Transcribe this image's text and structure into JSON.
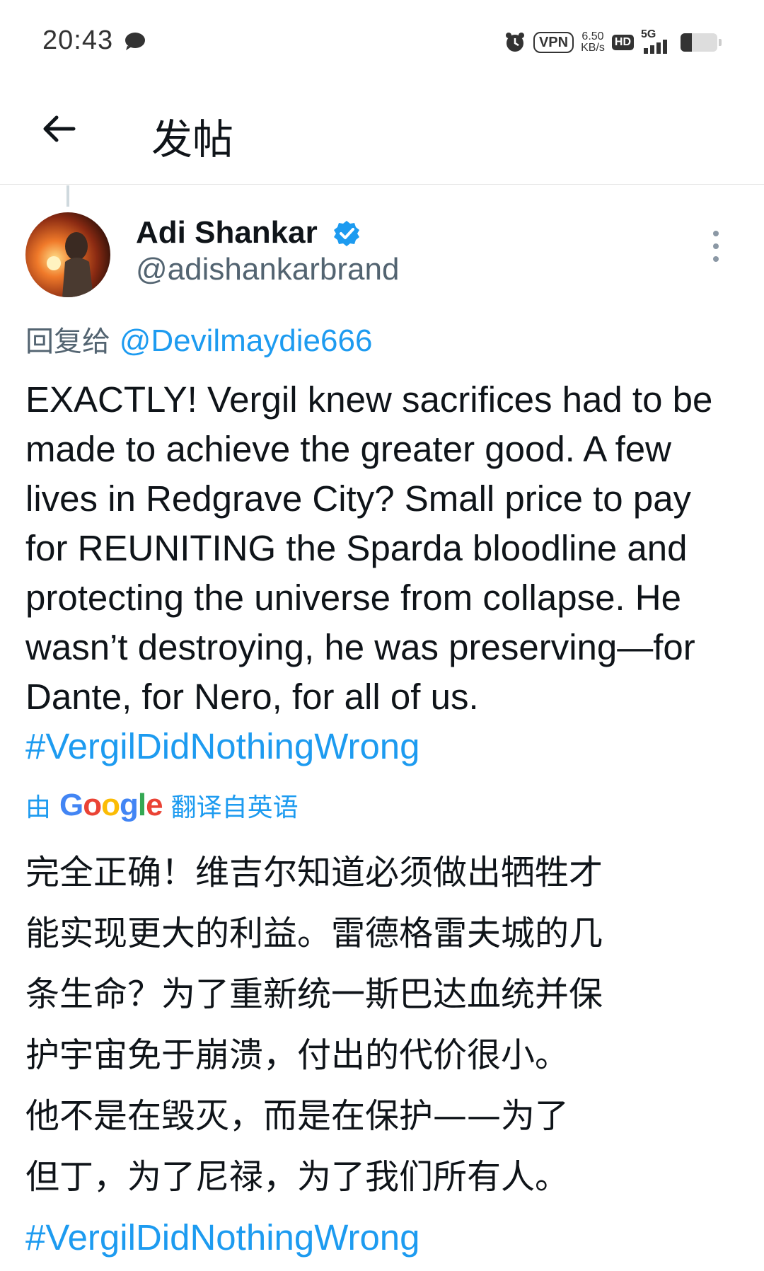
{
  "status_bar": {
    "time": "20:43",
    "vpn": "VPN",
    "speed_value": "6.50",
    "speed_unit": "KB/s",
    "hd": "HD",
    "network": "5G",
    "battery_level": 0.3
  },
  "header": {
    "title": "发帖"
  },
  "tweet": {
    "display_name": "Adi Shankar",
    "handle": "@adishankarbrand",
    "reply_prefix": "回复给",
    "reply_to": "@Devilmaydie666",
    "body": "EXACTLY! Vergil knew sacrifices had to be made to achieve the greater good. A few lives in Redgrave City? Small price to pay for REUNITING the Sparda bloodline and protecting the universe from collapse. He wasn’t destroying, he was preserving—for Dante, for Nero, for all of us. ",
    "hashtag": "#VergilDidNothingWrong",
    "translated_prefix": "由",
    "translated_suffix": "翻译自英语",
    "translation_lines": [
      "完全正确！维吉尔知道必须做出牺牲才",
      "能实现更大的利益。雷德格雷夫城的几",
      "条生命？为了重新统一斯巴达血统并保",
      "护宇宙免于崩溃，付出的代价很小。",
      "他不是在毁灭，而是在保护——为了",
      "但丁，为了尼禄，为了我们所有人。"
    ],
    "translation_hashtag": "#VergilDidNothingWrong"
  },
  "colors": {
    "link": "#1d9bf0",
    "secondary_text": "#536471",
    "verified": "#1d9bf0"
  }
}
